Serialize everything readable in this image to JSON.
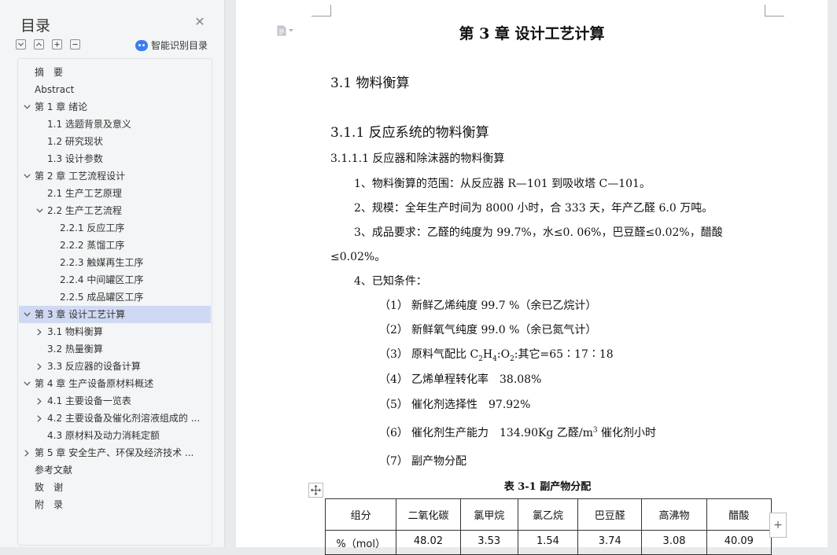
{
  "sidebar": {
    "title": "目录",
    "smart_toc_label": "智能识别目录",
    "tools": [
      "expand-all-icon",
      "collapse-all-icon",
      "add-item-icon",
      "remove-item-icon"
    ],
    "items": [
      {
        "label": "摘　要",
        "level": 0,
        "caret": "none"
      },
      {
        "label": "Abstract",
        "level": 0,
        "caret": "none"
      },
      {
        "label": "第 1 章  绪论",
        "level": 0,
        "caret": "down"
      },
      {
        "label": "1.1 选题背景及意义",
        "level": 1,
        "caret": "none"
      },
      {
        "label": "1.2 研究现状",
        "level": 1,
        "caret": "none"
      },
      {
        "label": "1.3 设计参数",
        "level": 1,
        "caret": "none"
      },
      {
        "label": "第 2 章  工艺流程设计",
        "level": 0,
        "caret": "down"
      },
      {
        "label": "2.1 生产工艺原理",
        "level": 1,
        "caret": "none"
      },
      {
        "label": "2.2 生产工艺流程",
        "level": 1,
        "caret": "down"
      },
      {
        "label": "2.2.1 反应工序",
        "level": 2,
        "caret": "none"
      },
      {
        "label": "2.2.2 蒸馏工序",
        "level": 2,
        "caret": "none"
      },
      {
        "label": "2.2.3 触媒再生工序",
        "level": 2,
        "caret": "none"
      },
      {
        "label": "2.2.4 中间罐区工序",
        "level": 2,
        "caret": "none"
      },
      {
        "label": "2.2.5 成品罐区工序",
        "level": 2,
        "caret": "none"
      },
      {
        "label": "第 3 章  设计工艺计算",
        "level": 0,
        "caret": "down",
        "active": true
      },
      {
        "label": "3.1 物料衡算",
        "level": 1,
        "caret": "right"
      },
      {
        "label": "3.2 热量衡算",
        "level": 1,
        "caret": "none"
      },
      {
        "label": "3.3 反应器的设备计算",
        "level": 1,
        "caret": "right"
      },
      {
        "label": "第 4 章  生产设备原材料概述",
        "level": 0,
        "caret": "down"
      },
      {
        "label": "4.1 主要设备一览表",
        "level": 1,
        "caret": "right"
      },
      {
        "label": "4.2 主要设备及催化剂溶液组成的 ...",
        "level": 1,
        "caret": "right"
      },
      {
        "label": "4.3 原材料及动力消耗定额",
        "level": 1,
        "caret": "none"
      },
      {
        "label": "第 5 章  安全生产、环保及经济技术 ...",
        "level": 0,
        "caret": "right"
      },
      {
        "label": "参考文献",
        "level": 0,
        "caret": "none"
      },
      {
        "label": "致　谢",
        "level": 0,
        "caret": "none"
      },
      {
        "label": "附　录",
        "level": 0,
        "caret": "none"
      }
    ]
  },
  "document": {
    "chapter_title": "第 3 章  设计工艺计算",
    "section": "3.1 物料衡算",
    "subsection": "3.1.1  反应系统的物料衡算",
    "subsubsection": "3.1.1.1  反应器和除沫器的物料衡算",
    "paragraphs": {
      "p1": "1、物料衡算的范围：从反应器 R—101 到吸收塔 C—101。",
      "p2": "2、规模：全年生产时间为 8000 小时，合 333 天，年产乙醛 6.0 万吨。",
      "p3": "3、成品要求：乙醛的纯度为 99.7%，水≤0. 06%，巴豆醛≤0.02%，醋酸",
      "p3_cont": "≤0.02%。",
      "p4": "4、已知条件："
    },
    "conditions": [
      {
        "num": "（1）",
        "text": "新鲜乙烯纯度 99.7 %（余已乙烷计）"
      },
      {
        "num": "（2）",
        "text": "新鲜氧气纯度 99.0 %（余已氮气计）"
      },
      {
        "num": "（3）",
        "text_prefix": "原料气配比  ",
        "formula": "C₂H₄:O₂",
        "text_suffix": ":其它=65∶17∶18"
      },
      {
        "num": "（4）",
        "text": "乙烯单程转化率　38.08%"
      },
      {
        "num": "（5）",
        "text": "催化剂选择性　97.92%"
      },
      {
        "num": "（6）",
        "text_prefix": "催化剂生产能力　134.90Kg 乙醛/m",
        "sup": "3",
        "text_suffix": " 催化剂小时"
      },
      {
        "num": "（7）",
        "text": "副产物分配"
      }
    ],
    "table": {
      "title": "表 3-1 副产物分配",
      "headers": [
        "组分",
        "二氧化碳",
        "氯甲烷",
        "氯乙烷",
        "巴豆醛",
        "高沸物",
        "醋酸"
      ],
      "row_label": "%（mol）",
      "values": [
        "48.02",
        "3.53",
        "1.54",
        "3.74",
        "3.08",
        "40.09"
      ]
    }
  }
}
